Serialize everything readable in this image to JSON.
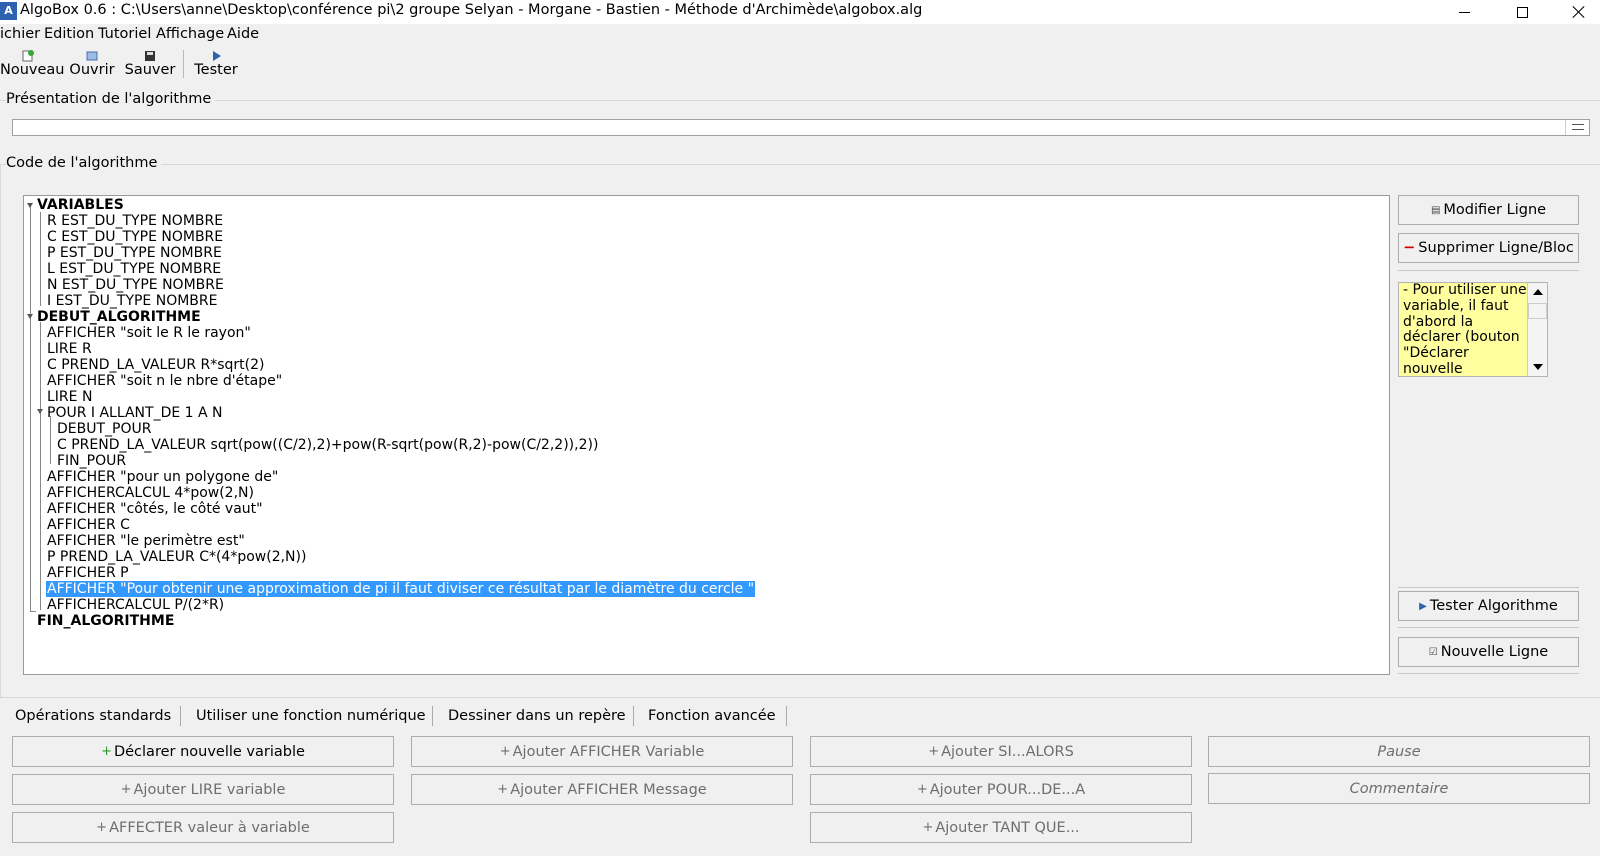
{
  "window": {
    "title": "AlgoBox 0.6 : C:\\Users\\anne\\Desktop\\conférence pi\\2 groupe Selyan - Morgane - Bastien - Méthode d'Archimède\\algobox.alg",
    "icon_label": "A"
  },
  "menu": [
    "ichier",
    "Edition",
    "Tutoriel",
    "Affichage",
    "Aide"
  ],
  "toolbar": {
    "new": "Nouveau",
    "open": "Ouvrir",
    "save": "Sauver",
    "test": "Tester"
  },
  "presentation": {
    "title": "Présentation de l'algorithme",
    "value": ""
  },
  "code": {
    "title": "Code de l'algorithme",
    "lines": [
      "VARIABLES",
      "R EST_DU_TYPE NOMBRE",
      "C EST_DU_TYPE NOMBRE",
      "P EST_DU_TYPE NOMBRE",
      "L EST_DU_TYPE NOMBRE",
      "N EST_DU_TYPE NOMBRE",
      "I EST_DU_TYPE NOMBRE",
      "DEBUT_ALGORITHME",
      "AFFICHER \"soit le R le rayon\"",
      "LIRE R",
      "C PREND_LA_VALEUR R*sqrt(2)",
      "AFFICHER \"soit n le nbre d'étape\"",
      "LIRE N",
      "POUR I ALLANT_DE 1 A N",
      "DEBUT_POUR",
      "C PREND_LA_VALEUR sqrt(pow((C/2),2)+pow(R-sqrt(pow(R,2)-pow(C/2,2)),2))",
      "FIN_POUR",
      "AFFICHER \"pour un polygone de\"",
      "AFFICHERCALCUL 4*pow(2,N)",
      "AFFICHER \"côtés, le côté vaut\"",
      "AFFICHER C",
      "AFFICHER \"le perimètre est\"",
      "P PREND_LA_VALEUR C*(4*pow(2,N))",
      "AFFICHER P",
      "AFFICHER \"Pour obtenir une approximation de pi il faut diviser ce résultat par le diamètre du cercle \"",
      "AFFICHERCALCUL P/(2*R)",
      "FIN_ALGORITHME"
    ]
  },
  "side": {
    "modify": "Modifier Ligne",
    "delete": "Supprimer Ligne/Bloc",
    "help": "- Pour utiliser une variable, il faut d'abord la déclarer (bouton \"Déclarer nouvelle",
    "test_algo": "Tester Algorithme",
    "new_line": "Nouvelle Ligne"
  },
  "tabs": [
    "Opérations standards",
    "Utiliser une fonction numérique",
    "Dessiner dans un repère",
    "Fonction avancée"
  ],
  "ops": {
    "declare_var": "Déclarer nouvelle variable",
    "read_var": "Ajouter LIRE variable",
    "assign": "AFFECTER valeur à variable",
    "print_var": "Ajouter AFFICHER Variable",
    "print_msg": "Ajouter AFFICHER Message",
    "if": "Ajouter SI...ALORS",
    "for": "Ajouter POUR...DE...A",
    "while": "Ajouter TANT QUE...",
    "pause": "Pause",
    "comment": "Commentaire"
  },
  "colors": {
    "selection": "#3399ff",
    "help_bg": "#ffffa0",
    "accent_plus": "#2a9a2a",
    "accent_minus": "#d00000"
  }
}
